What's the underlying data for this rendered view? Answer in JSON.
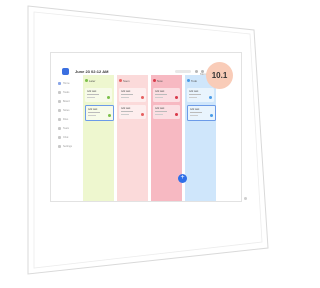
{
  "header": {
    "datetime": "June 23  02:12 AM",
    "badge": "10.1",
    "top_right_text": "Monday 02:48"
  },
  "sidebar": {
    "items": [
      {
        "label": "Home"
      },
      {
        "label": "Tasks"
      },
      {
        "label": "Board"
      },
      {
        "label": "Notes"
      },
      {
        "label": "Files"
      },
      {
        "label": "Team"
      },
      {
        "label": "Chat"
      },
      {
        "label": "Settings"
      }
    ]
  },
  "columns": [
    {
      "title": "Later",
      "color": "#7cc04a",
      "bg": "#eef7cf",
      "cards": [
        {
          "title": "Add task"
        },
        {
          "title": "Add task"
        }
      ]
    },
    {
      "title": "Soon",
      "color": "#e66060",
      "bg": "#fbdada",
      "cards": [
        {
          "title": "Add task"
        },
        {
          "title": "Add task"
        }
      ]
    },
    {
      "title": "Now",
      "color": "#d93a4a",
      "bg": "#f7b9c2",
      "cards": [
        {
          "title": "Add task"
        },
        {
          "title": "Add task"
        }
      ]
    },
    {
      "title": "Todo",
      "color": "#4a9be8",
      "bg": "#cfe6fb",
      "cards": [
        {
          "title": "Add task"
        },
        {
          "title": "Add task"
        }
      ]
    }
  ],
  "fab_icon": "plus-icon",
  "fab_label": "+"
}
